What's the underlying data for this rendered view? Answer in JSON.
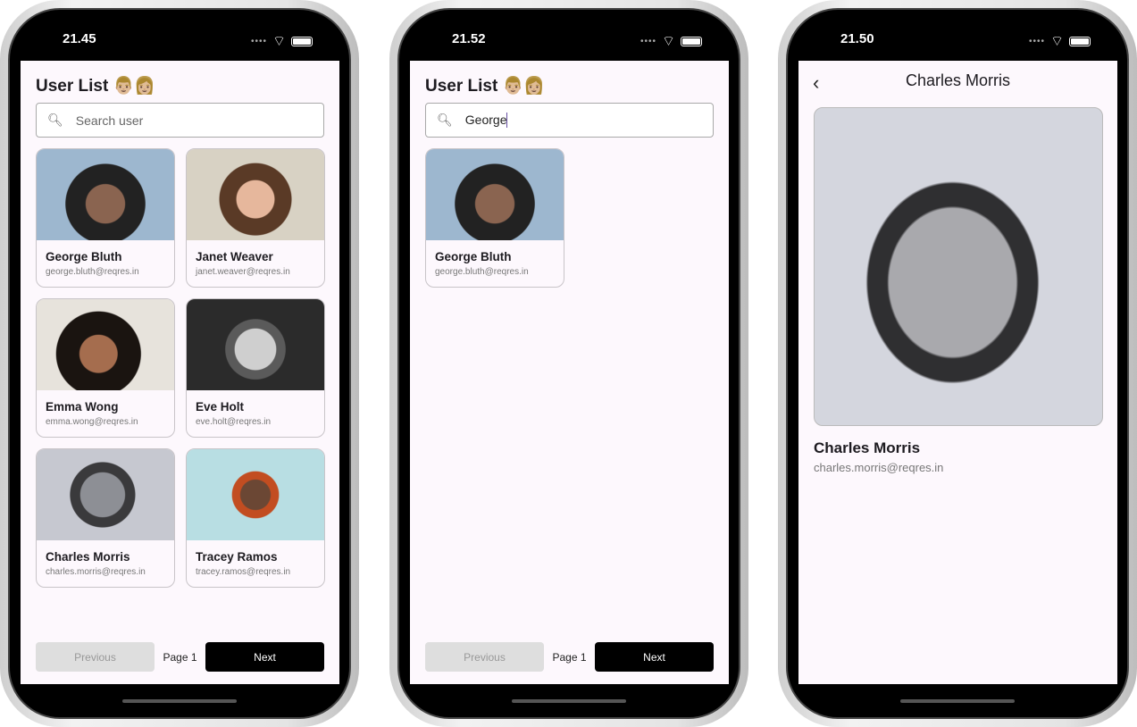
{
  "phones": [
    {
      "time": "21.45",
      "title": "User List 👨🏼👩🏼",
      "search_placeholder": "Search user",
      "users": [
        {
          "name": "George Bluth",
          "email": "george.bluth@reqres.in"
        },
        {
          "name": "Janet Weaver",
          "email": "janet.weaver@reqres.in"
        },
        {
          "name": "Emma Wong",
          "email": "emma.wong@reqres.in"
        },
        {
          "name": "Eve Holt",
          "email": "eve.holt@reqres.in"
        },
        {
          "name": "Charles Morris",
          "email": "charles.morris@reqres.in"
        },
        {
          "name": "Tracey Ramos",
          "email": "tracey.ramos@reqres.in"
        }
      ],
      "pager": {
        "previous": "Previous",
        "page": "Page 1",
        "next": "Next"
      }
    },
    {
      "time": "21.52",
      "title": "User List 👨🏼👩🏼",
      "search_value": "George",
      "users": [
        {
          "name": "George Bluth",
          "email": "george.bluth@reqres.in"
        }
      ],
      "pager": {
        "previous": "Previous",
        "page": "Page 1",
        "next": "Next"
      }
    },
    {
      "time": "21.50",
      "header": "Charles Morris",
      "back": "‹",
      "name": "Charles Morris",
      "email": "charles.morris@reqres.in"
    }
  ]
}
